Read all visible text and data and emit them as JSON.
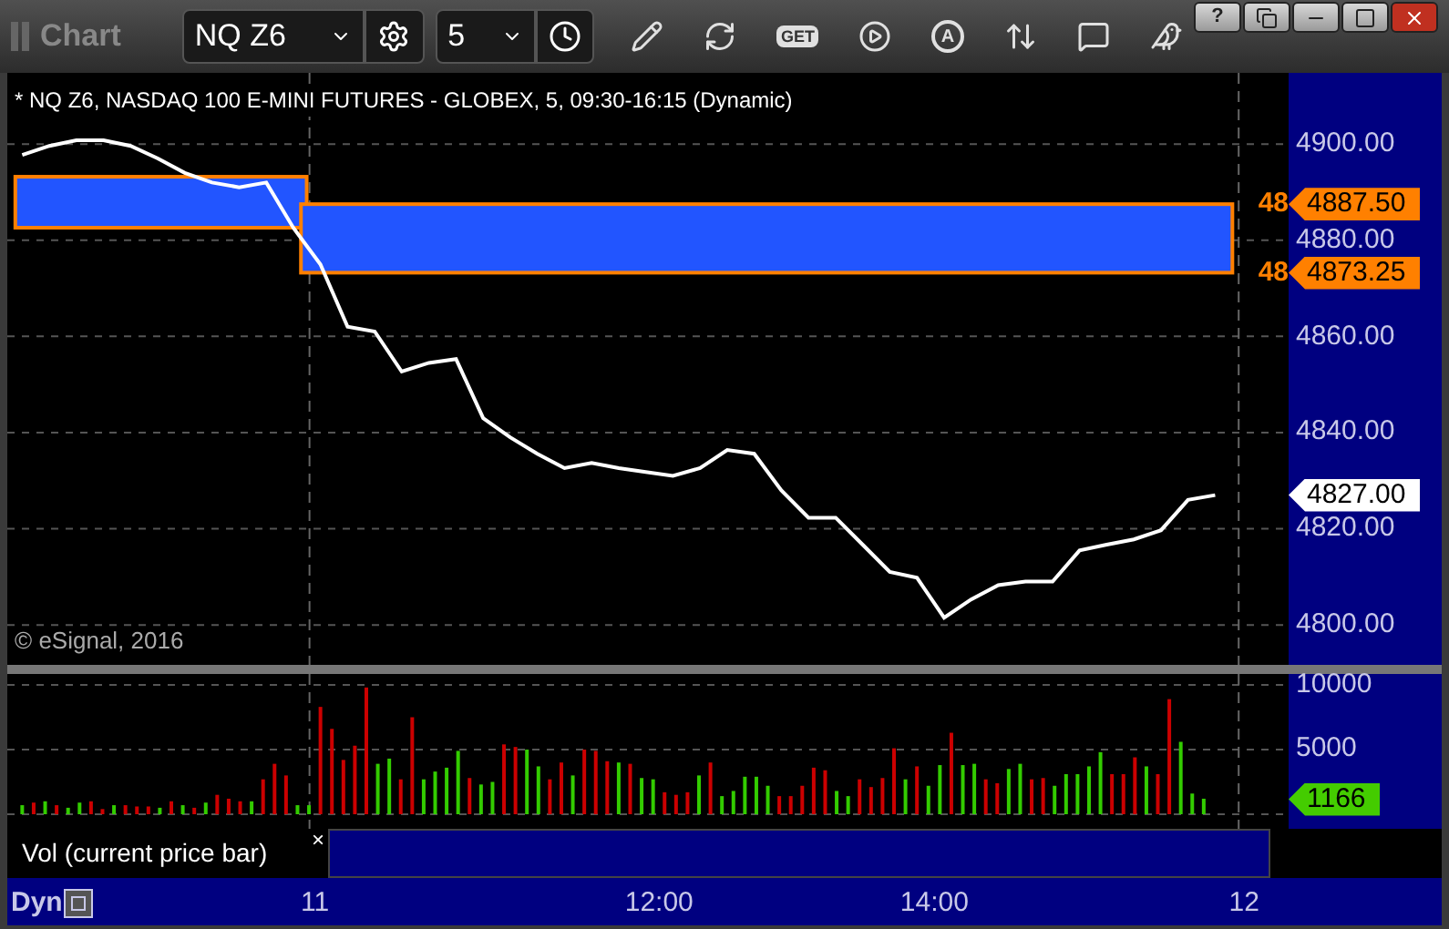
{
  "toolbar": {
    "title": "Chart",
    "symbol": "NQ Z6",
    "interval": "5",
    "tools": [
      {
        "kind": "pencil"
      },
      {
        "kind": "refresh"
      },
      {
        "kind": "get",
        "label": "GET"
      },
      {
        "kind": "play"
      },
      {
        "kind": "alert",
        "label": "A"
      },
      {
        "kind": "swap"
      },
      {
        "kind": "comment"
      },
      {
        "kind": "bird"
      }
    ],
    "window_buttons": [
      {
        "kind": "help",
        "label": "?"
      },
      {
        "kind": "restore"
      },
      {
        "kind": "minimize"
      },
      {
        "kind": "maximize"
      },
      {
        "kind": "close"
      }
    ]
  },
  "price_panel": {
    "title": "* NQ Z6, NASDAQ 100 E-MINI FUTURES - GLOBEX, 5, 09:30-16:15 (Dynamic)",
    "copyright": "© eSignal, 2016",
    "chart_data": {
      "type": "line",
      "grid": true,
      "ylim": [
        4791.7,
        4914.8
      ],
      "yticks": [
        {
          "value": 4800,
          "label": "4800.00"
        },
        {
          "value": 4820,
          "label": "4820.00"
        },
        {
          "value": 4840,
          "label": "4840.00"
        },
        {
          "value": 4860,
          "label": "4860.00"
        },
        {
          "value": 4880,
          "label": "4880.00"
        },
        {
          "value": 4900,
          "label": "4900.00"
        }
      ],
      "categories": [
        null,
        null,
        null,
        null,
        null,
        null,
        null,
        null,
        null,
        null,
        null,
        null,
        null,
        null,
        null,
        null,
        null,
        null,
        null,
        null,
        null,
        null,
        null,
        null,
        null,
        null,
        null,
        null,
        null,
        null,
        null,
        null,
        null,
        null,
        null,
        null,
        null,
        null,
        null,
        null,
        null,
        null,
        null,
        null,
        null
      ],
      "series": [
        {
          "color": "#ffffff",
          "values": [
            4897.7,
            4899.6,
            4900.8,
            4900.8,
            4899.6,
            4897,
            4894,
            4892,
            4891,
            4892,
            4882.6,
            4875,
            4862,
            4861,
            4852.7,
            4854.5,
            4855.3,
            4843,
            4839,
            4835.6,
            4832.6,
            4833.7,
            4832.6,
            4831.8,
            4831,
            4832.6,
            4836.4,
            4835.6,
            4828,
            4822.3,
            4822.3,
            4816.7,
            4811,
            4809.8,
            4801.5,
            4805.3,
            4808.3,
            4809,
            4809,
            4815.5,
            4816.7,
            4817.8,
            4819.7,
            4826,
            4827
          ]
        }
      ],
      "annotations": [
        "48",
        "48"
      ]
    },
    "price_flags": [
      {
        "label": "4887.50",
        "color": "#ff8000"
      },
      {
        "label": "4873.25",
        "color": "#ff8000"
      },
      {
        "label": "4827.00",
        "color": "#ffffff"
      }
    ]
  },
  "volume_panel": {
    "legend": "Vol (current price bar)",
    "close": "×",
    "chart_data": {
      "type": "bar",
      "grid": true,
      "ylim": [
        -1127,
        10845
      ],
      "yticks": [
        {
          "value": 5000,
          "label": "5000"
        },
        {
          "value": 10000,
          "label": "10000"
        }
      ],
      "categories": [
        null,
        null,
        null,
        null,
        null,
        null,
        null,
        null,
        null,
        null,
        null,
        null,
        null,
        null,
        null,
        null,
        null,
        null,
        null,
        null,
        null,
        null,
        null,
        null,
        null,
        null,
        "11",
        null,
        null,
        null,
        null,
        null,
        null,
        null,
        null,
        null,
        null,
        null,
        null,
        null,
        null,
        null,
        null,
        null,
        null,
        null,
        null,
        null,
        null,
        null,
        null,
        null,
        null,
        null,
        null,
        null,
        "12:00",
        null,
        null,
        null,
        null,
        null,
        null,
        null,
        null,
        null,
        null,
        null,
        null,
        null,
        null,
        null,
        null,
        null,
        null,
        null,
        null,
        null,
        null,
        null,
        "14:00",
        null,
        null,
        null,
        null,
        null,
        null,
        null,
        null,
        null,
        null,
        null,
        null,
        null,
        null,
        null,
        null,
        null,
        null,
        null,
        null,
        null,
        null,
        null,
        null,
        null,
        null,
        "12"
      ],
      "series": [
        {
          "color": "#33cc00",
          "values": [
            700,
            null,
            1000,
            null,
            500,
            900,
            null,
            null,
            700,
            null,
            null,
            null,
            500,
            null,
            700,
            null,
            900,
            null,
            null,
            null,
            1000,
            null,
            null,
            null,
            700,
            700,
            null,
            null,
            null,
            null,
            null,
            3900,
            4300,
            null,
            null,
            2700,
            3300,
            3600,
            4900,
            null,
            2300,
            2500,
            null,
            null,
            5000,
            3700,
            null,
            null,
            3000,
            null,
            null,
            null,
            4000,
            null,
            2800,
            2700,
            null,
            null,
            null,
            3000,
            null,
            1400,
            1800,
            2900,
            2900,
            2200,
            null,
            null,
            null,
            null,
            null,
            1800,
            1400,
            null,
            null,
            null,
            null,
            2700,
            null,
            2200,
            3800,
            null,
            3800,
            3900,
            null,
            null,
            3500,
            3900,
            null,
            null,
            2200,
            3100,
            3100,
            3700,
            4800,
            null,
            null,
            null,
            3700,
            null,
            null,
            5600,
            1600,
            1200,
            null,
            null,
            null,
            null
          ]
        },
        {
          "color": "#cc0000",
          "values": [
            null,
            900,
            null,
            700,
            null,
            null,
            1000,
            400,
            null,
            700,
            600,
            600,
            null,
            1000,
            null,
            500,
            null,
            1500,
            1200,
            1000,
            null,
            2700,
            3900,
            3000,
            null,
            null,
            8300,
            6600,
            4200,
            5300,
            9800,
            null,
            null,
            2700,
            7500,
            null,
            null,
            null,
            null,
            2800,
            null,
            null,
            5400,
            5200,
            null,
            null,
            2700,
            4000,
            null,
            5000,
            4900,
            4100,
            null,
            3900,
            null,
            null,
            1700,
            1500,
            1700,
            null,
            4000,
            null,
            null,
            null,
            null,
            null,
            1400,
            1400,
            2200,
            3600,
            3400,
            null,
            null,
            2700,
            2100,
            2800,
            5100,
            null,
            3700,
            null,
            null,
            6300,
            null,
            null,
            2700,
            2400,
            null,
            null,
            2700,
            2800,
            null,
            null,
            null,
            null,
            null,
            3100,
            3100,
            4400,
            null,
            3100,
            8900,
            null,
            null,
            null,
            null,
            null,
            null,
            null
          ]
        }
      ]
    },
    "price_flags": [
      {
        "label": "1166",
        "color": "#44cc00"
      }
    ]
  },
  "time_axis": {
    "mode": "Dyn"
  }
}
